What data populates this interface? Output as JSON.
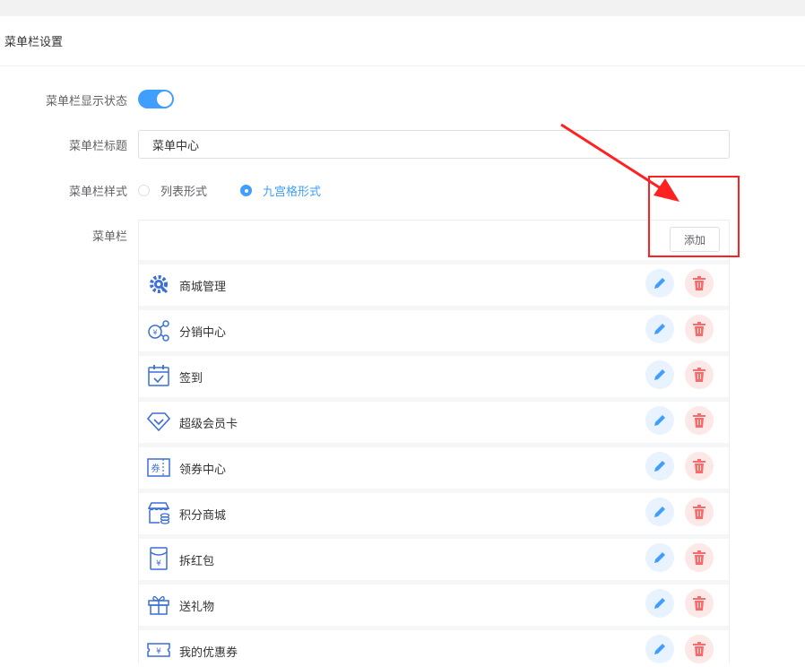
{
  "section_title": "菜单栏设置",
  "form": {
    "status_label": "菜单栏显示状态",
    "status_on": true,
    "title_label": "菜单栏标题",
    "title_value": "菜单中心",
    "style_label": "菜单栏样式",
    "style_options": [
      "列表形式",
      "九宫格形式"
    ],
    "style_selected": "九宫格形式",
    "menu_label": "菜单栏",
    "add_label": "添加"
  },
  "colors": {
    "primary": "#409eff",
    "danger": "#f56c6c",
    "annotation": "#ff2020"
  },
  "menu_items": [
    {
      "name": "商城管理",
      "icon": "gear-shop-icon"
    },
    {
      "name": "分销中心",
      "icon": "distribution-icon"
    },
    {
      "name": "签到",
      "icon": "calendar-check-icon"
    },
    {
      "name": "超级会员卡",
      "icon": "diamond-icon"
    },
    {
      "name": "领券中心",
      "icon": "coupon-center-icon"
    },
    {
      "name": "积分商城",
      "icon": "store-coins-icon"
    },
    {
      "name": "拆红包",
      "icon": "red-packet-icon"
    },
    {
      "name": "送礼物",
      "icon": "gift-icon"
    },
    {
      "name": "我的优惠券",
      "icon": "my-coupon-icon"
    }
  ]
}
